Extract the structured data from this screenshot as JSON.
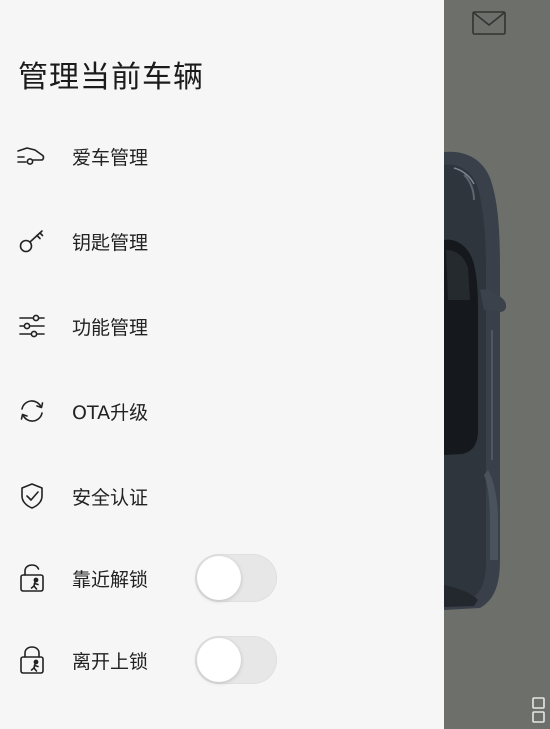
{
  "drawer": {
    "title": "管理当前车辆",
    "items": [
      {
        "icon": "car-wash-icon",
        "label": "爱车管理"
      },
      {
        "icon": "key-icon",
        "label": "钥匙管理"
      },
      {
        "icon": "sliders-icon",
        "label": "功能管理"
      },
      {
        "icon": "refresh-icon",
        "label": "OTA升级"
      },
      {
        "icon": "shield-check-icon",
        "label": "安全认证"
      },
      {
        "icon": "lock-unlock-icon",
        "label": "靠近解锁",
        "toggle": false
      },
      {
        "icon": "lock-walk-icon",
        "label": "离开上锁",
        "toggle": false
      }
    ]
  },
  "background": {
    "panel_color": "#6d6f6b",
    "header_icon": "mail-icon",
    "corner_icon": "grid-icon"
  }
}
